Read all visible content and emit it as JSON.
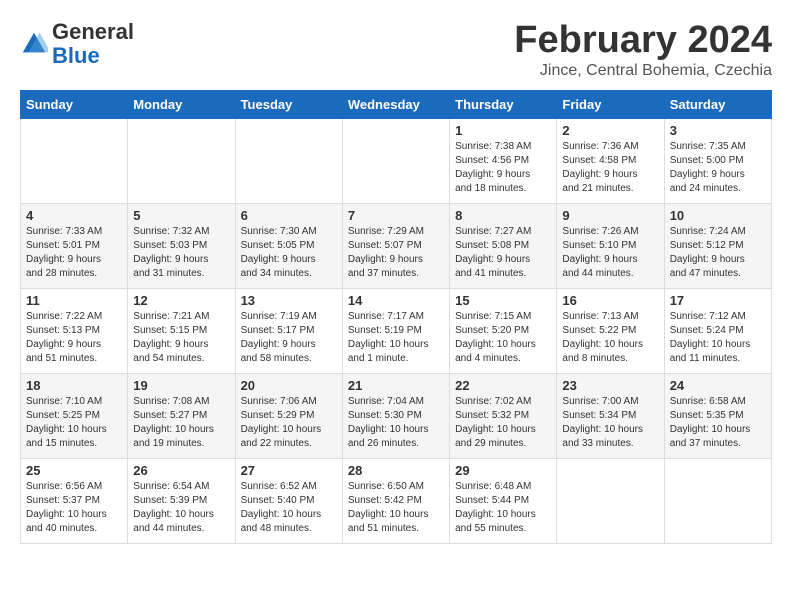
{
  "header": {
    "logo": {
      "general": "General",
      "blue": "Blue"
    },
    "title": "February 2024",
    "location": "Jince, Central Bohemia, Czechia"
  },
  "days_of_week": [
    "Sunday",
    "Monday",
    "Tuesday",
    "Wednesday",
    "Thursday",
    "Friday",
    "Saturday"
  ],
  "weeks": [
    [
      {
        "day": "",
        "info": ""
      },
      {
        "day": "",
        "info": ""
      },
      {
        "day": "",
        "info": ""
      },
      {
        "day": "",
        "info": ""
      },
      {
        "day": "1",
        "info": "Sunrise: 7:38 AM\nSunset: 4:56 PM\nDaylight: 9 hours\nand 18 minutes."
      },
      {
        "day": "2",
        "info": "Sunrise: 7:36 AM\nSunset: 4:58 PM\nDaylight: 9 hours\nand 21 minutes."
      },
      {
        "day": "3",
        "info": "Sunrise: 7:35 AM\nSunset: 5:00 PM\nDaylight: 9 hours\nand 24 minutes."
      }
    ],
    [
      {
        "day": "4",
        "info": "Sunrise: 7:33 AM\nSunset: 5:01 PM\nDaylight: 9 hours\nand 28 minutes."
      },
      {
        "day": "5",
        "info": "Sunrise: 7:32 AM\nSunset: 5:03 PM\nDaylight: 9 hours\nand 31 minutes."
      },
      {
        "day": "6",
        "info": "Sunrise: 7:30 AM\nSunset: 5:05 PM\nDaylight: 9 hours\nand 34 minutes."
      },
      {
        "day": "7",
        "info": "Sunrise: 7:29 AM\nSunset: 5:07 PM\nDaylight: 9 hours\nand 37 minutes."
      },
      {
        "day": "8",
        "info": "Sunrise: 7:27 AM\nSunset: 5:08 PM\nDaylight: 9 hours\nand 41 minutes."
      },
      {
        "day": "9",
        "info": "Sunrise: 7:26 AM\nSunset: 5:10 PM\nDaylight: 9 hours\nand 44 minutes."
      },
      {
        "day": "10",
        "info": "Sunrise: 7:24 AM\nSunset: 5:12 PM\nDaylight: 9 hours\nand 47 minutes."
      }
    ],
    [
      {
        "day": "11",
        "info": "Sunrise: 7:22 AM\nSunset: 5:13 PM\nDaylight: 9 hours\nand 51 minutes."
      },
      {
        "day": "12",
        "info": "Sunrise: 7:21 AM\nSunset: 5:15 PM\nDaylight: 9 hours\nand 54 minutes."
      },
      {
        "day": "13",
        "info": "Sunrise: 7:19 AM\nSunset: 5:17 PM\nDaylight: 9 hours\nand 58 minutes."
      },
      {
        "day": "14",
        "info": "Sunrise: 7:17 AM\nSunset: 5:19 PM\nDaylight: 10 hours\nand 1 minute."
      },
      {
        "day": "15",
        "info": "Sunrise: 7:15 AM\nSunset: 5:20 PM\nDaylight: 10 hours\nand 4 minutes."
      },
      {
        "day": "16",
        "info": "Sunrise: 7:13 AM\nSunset: 5:22 PM\nDaylight: 10 hours\nand 8 minutes."
      },
      {
        "day": "17",
        "info": "Sunrise: 7:12 AM\nSunset: 5:24 PM\nDaylight: 10 hours\nand 11 minutes."
      }
    ],
    [
      {
        "day": "18",
        "info": "Sunrise: 7:10 AM\nSunset: 5:25 PM\nDaylight: 10 hours\nand 15 minutes."
      },
      {
        "day": "19",
        "info": "Sunrise: 7:08 AM\nSunset: 5:27 PM\nDaylight: 10 hours\nand 19 minutes."
      },
      {
        "day": "20",
        "info": "Sunrise: 7:06 AM\nSunset: 5:29 PM\nDaylight: 10 hours\nand 22 minutes."
      },
      {
        "day": "21",
        "info": "Sunrise: 7:04 AM\nSunset: 5:30 PM\nDaylight: 10 hours\nand 26 minutes."
      },
      {
        "day": "22",
        "info": "Sunrise: 7:02 AM\nSunset: 5:32 PM\nDaylight: 10 hours\nand 29 minutes."
      },
      {
        "day": "23",
        "info": "Sunrise: 7:00 AM\nSunset: 5:34 PM\nDaylight: 10 hours\nand 33 minutes."
      },
      {
        "day": "24",
        "info": "Sunrise: 6:58 AM\nSunset: 5:35 PM\nDaylight: 10 hours\nand 37 minutes."
      }
    ],
    [
      {
        "day": "25",
        "info": "Sunrise: 6:56 AM\nSunset: 5:37 PM\nDaylight: 10 hours\nand 40 minutes."
      },
      {
        "day": "26",
        "info": "Sunrise: 6:54 AM\nSunset: 5:39 PM\nDaylight: 10 hours\nand 44 minutes."
      },
      {
        "day": "27",
        "info": "Sunrise: 6:52 AM\nSunset: 5:40 PM\nDaylight: 10 hours\nand 48 minutes."
      },
      {
        "day": "28",
        "info": "Sunrise: 6:50 AM\nSunset: 5:42 PM\nDaylight: 10 hours\nand 51 minutes."
      },
      {
        "day": "29",
        "info": "Sunrise: 6:48 AM\nSunset: 5:44 PM\nDaylight: 10 hours\nand 55 minutes."
      },
      {
        "day": "",
        "info": ""
      },
      {
        "day": "",
        "info": ""
      }
    ]
  ]
}
